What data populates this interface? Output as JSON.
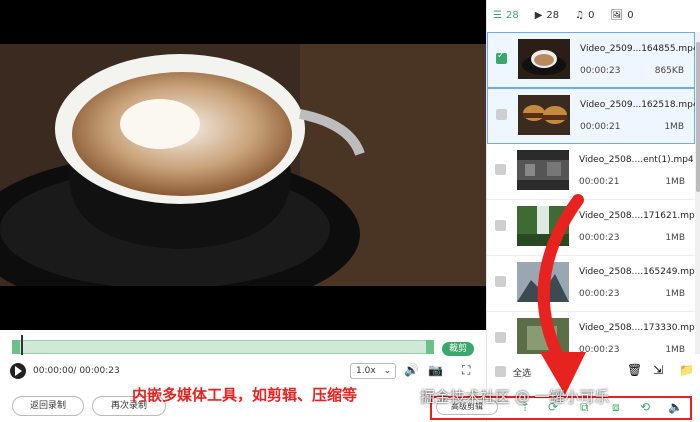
{
  "tabs": [
    {
      "label": "28",
      "icon": "list-icon"
    },
    {
      "label": "28",
      "icon": "video-icon"
    },
    {
      "label": "0",
      "icon": "music-icon"
    },
    {
      "label": "0",
      "icon": "image-icon"
    }
  ],
  "files": [
    {
      "name": "Video_2509...164855.mp4",
      "duration": "00:00:23",
      "size": "865KB",
      "checked": true,
      "selected": true
    },
    {
      "name": "Video_2509...162518.mp4",
      "duration": "00:00:21",
      "size": "1MB",
      "checked": false,
      "selected": true
    },
    {
      "name": "Video_2508....ent(1).mp4",
      "duration": "00:00:21",
      "size": "1MB",
      "checked": false,
      "selected": false
    },
    {
      "name": "Video_2508....171621.mp4",
      "duration": "00:00:23",
      "size": "1MB",
      "checked": false,
      "selected": false
    },
    {
      "name": "Video_2508....165249.mp4",
      "duration": "00:00:23",
      "size": "1MB",
      "checked": false,
      "selected": false
    },
    {
      "name": "Video_2508....173330.mp4",
      "duration": "00:00:23",
      "size": "1MB",
      "checked": false,
      "selected": false
    }
  ],
  "select_all_label": "全选",
  "player": {
    "time": "00:00:00/ 00:00:23",
    "speed": "1.0x",
    "clip_button": "裁剪"
  },
  "buttons": {
    "back_record": "返回录制",
    "record_again": "再次录制",
    "advanced_edit": "高级剪辑"
  },
  "annotation_text": "内嵌多媒体工具，如剪辑、压缩等",
  "watermark": "掘金技术社区 @ 一罐小可乐",
  "colors": {
    "accent": "#3aa86a",
    "annotation": "#e8231f"
  }
}
